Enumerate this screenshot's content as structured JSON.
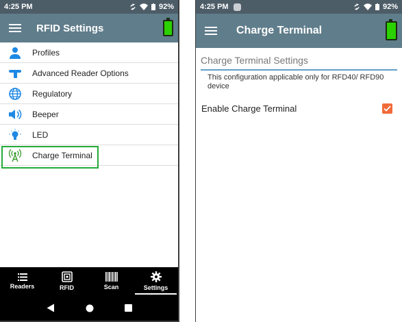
{
  "left": {
    "status": {
      "time": "4:25 PM",
      "battery": "92%"
    },
    "appbar": {
      "title": "RFID Settings"
    },
    "items": [
      {
        "label": "Profiles"
      },
      {
        "label": "Advanced Reader Options"
      },
      {
        "label": "Regulatory"
      },
      {
        "label": "Beeper"
      },
      {
        "label": "LED"
      },
      {
        "label": "Charge Terminal"
      }
    ],
    "bottom_nav": [
      {
        "label": "Readers"
      },
      {
        "label": "RFID"
      },
      {
        "label": "Scan"
      },
      {
        "label": "Settings"
      }
    ]
  },
  "right": {
    "status": {
      "time": "4:25 PM",
      "battery": "92%"
    },
    "appbar": {
      "title": "Charge Terminal"
    },
    "section_title": "Charge Terminal Settings",
    "note": "This configuration applicable only for RFD40/ RFD90 device",
    "enable_label": "Enable Charge Terminal",
    "enable_checked": true
  },
  "colors": {
    "statusbar": "#4d5d68",
    "appbar": "#607d8b",
    "icon_blue": "#1e88e5",
    "highlight_green": "#22aa36",
    "checkbox_orange": "#f16b3a",
    "battery_green": "#2bd100",
    "divider_blue": "#5f9fc9"
  },
  "icons": {
    "profiles": "person-icon",
    "advanced": "reader-icon",
    "regulatory": "globe-icon",
    "beeper": "speaker-icon",
    "led": "bulb-icon",
    "charge": "antenna-icon",
    "readers": "list-icon",
    "rfid": "rfid-tag-icon",
    "scan": "barcode-icon",
    "settings": "gear-icon"
  }
}
